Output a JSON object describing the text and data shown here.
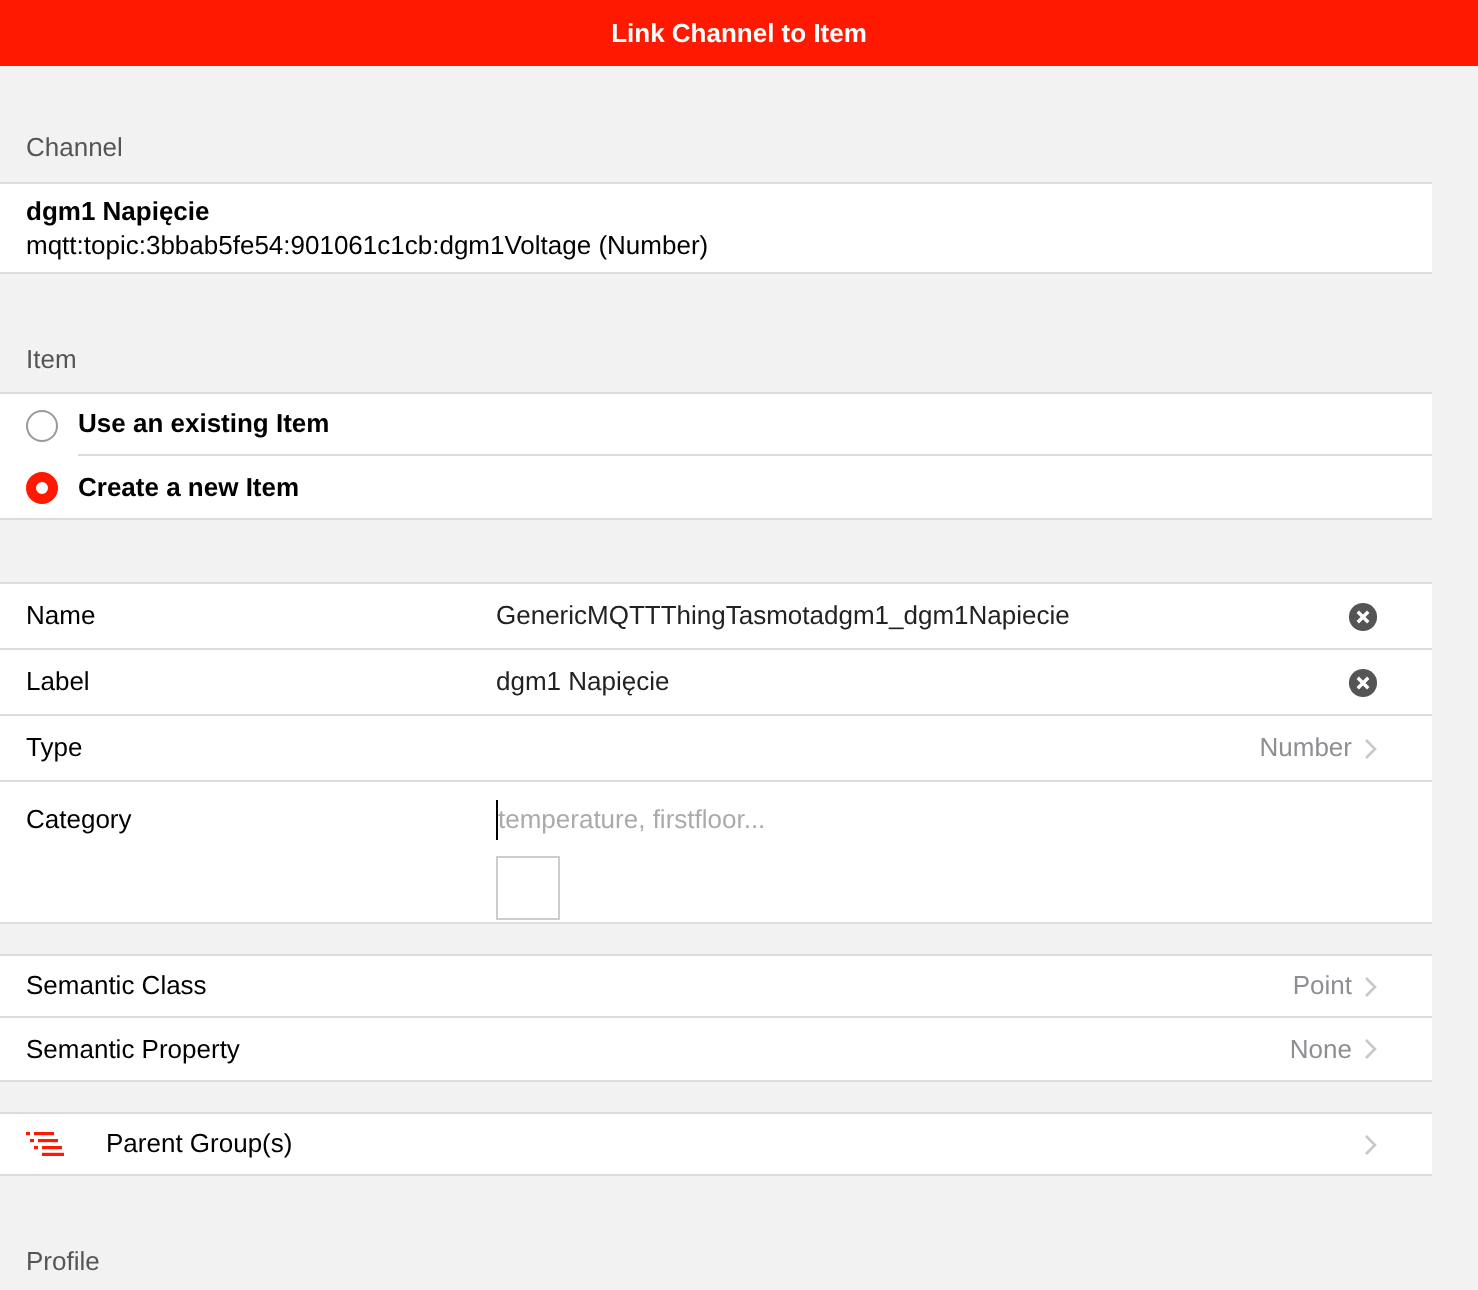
{
  "title": "Link Channel to Item",
  "channel": {
    "heading": "Channel",
    "name": "dgm1 Napięcie",
    "uid": "mqtt:topic:3bbab5fe54:901061c1cb:dgm1Voltage (Number)"
  },
  "item": {
    "heading": "Item",
    "options": [
      {
        "label": "Use an existing Item",
        "selected": false
      },
      {
        "label": "Create a new Item",
        "selected": true
      }
    ]
  },
  "fields": [
    {
      "kind": "text",
      "label": "Name",
      "value": "GenericMQTTThingTasmotadgm1_dgm1Napiecie"
    },
    {
      "kind": "text",
      "label": "Label",
      "value": "dgm1 Napięcie"
    },
    {
      "kind": "select",
      "label": "Type",
      "value": "Number"
    },
    {
      "kind": "category",
      "label": "Category",
      "placeholder": "temperature, firstfloor..."
    }
  ],
  "semantics": [
    {
      "label": "Semantic Class",
      "value": "Point"
    },
    {
      "label": "Semantic Property",
      "value": "None"
    }
  ],
  "parent_groups": {
    "label": "Parent Group(s)"
  },
  "profile": {
    "heading": "Profile"
  }
}
